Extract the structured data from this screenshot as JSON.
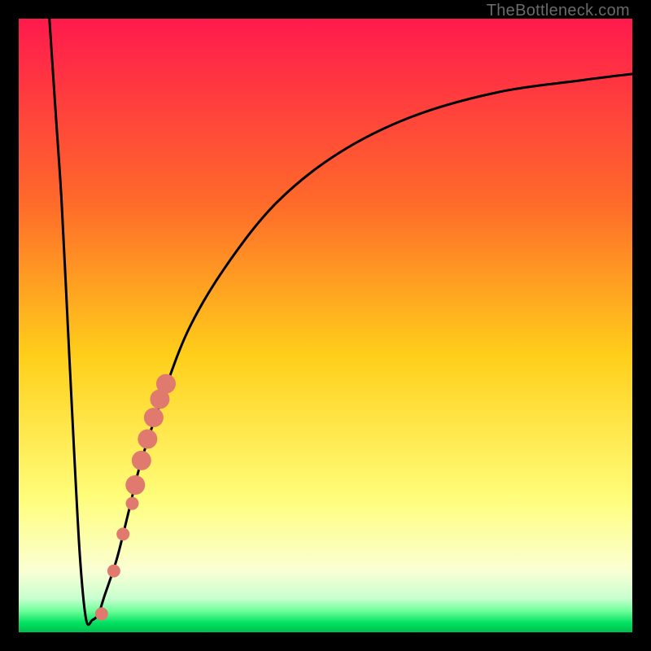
{
  "attribution": "TheBottleneck.com",
  "colors": {
    "bg_top": "#ff1a4d",
    "bg_mid1": "#ff8a1a",
    "bg_mid2": "#ffe81a",
    "bg_mid3": "#f7ff8e",
    "bg_green_light": "#9dffb0",
    "bg_green": "#00e060",
    "curve": "#000000",
    "markers": "#e07a6f",
    "frame": "#000000"
  },
  "chart_data": {
    "type": "line",
    "title": "",
    "xlabel": "",
    "ylabel": "",
    "xlim": [
      0,
      100
    ],
    "ylim": [
      0,
      100
    ],
    "series": [
      {
        "name": "bottleneck-curve",
        "x": [
          5,
          6,
          7,
          8,
          9,
          10,
          11,
          12,
          13,
          14,
          16,
          18,
          20,
          24,
          28,
          34,
          42,
          52,
          64,
          78,
          92,
          100
        ],
        "y": [
          100,
          85,
          70,
          50,
          30,
          12,
          2,
          2,
          3,
          6,
          12,
          20,
          28,
          40,
          50,
          60,
          70,
          78,
          84,
          88,
          90,
          91
        ]
      }
    ],
    "markers": [
      {
        "x": 13.5,
        "y": 3.0,
        "r": 8
      },
      {
        "x": 15.5,
        "y": 10.0,
        "r": 8
      },
      {
        "x": 17.0,
        "y": 16.0,
        "r": 8
      },
      {
        "x": 18.5,
        "y": 21.0,
        "r": 8
      },
      {
        "x": 19.0,
        "y": 24.0,
        "r": 12
      },
      {
        "x": 20.0,
        "y": 28.0,
        "r": 12
      },
      {
        "x": 21.0,
        "y": 31.5,
        "r": 12
      },
      {
        "x": 22.0,
        "y": 35.0,
        "r": 12
      },
      {
        "x": 23.0,
        "y": 38.0,
        "r": 12
      },
      {
        "x": 24.0,
        "y": 40.5,
        "r": 12
      }
    ],
    "gradient_stops": [
      {
        "offset": 0.0,
        "color": "#ff1a4d"
      },
      {
        "offset": 0.3,
        "color": "#ff6a2a"
      },
      {
        "offset": 0.55,
        "color": "#ffcf1a"
      },
      {
        "offset": 0.78,
        "color": "#fffd7a"
      },
      {
        "offset": 0.9,
        "color": "#faffd4"
      },
      {
        "offset": 0.945,
        "color": "#c8ffcf"
      },
      {
        "offset": 0.965,
        "color": "#6fff9a"
      },
      {
        "offset": 0.985,
        "color": "#00e060"
      },
      {
        "offset": 1.0,
        "color": "#00c050"
      }
    ]
  }
}
